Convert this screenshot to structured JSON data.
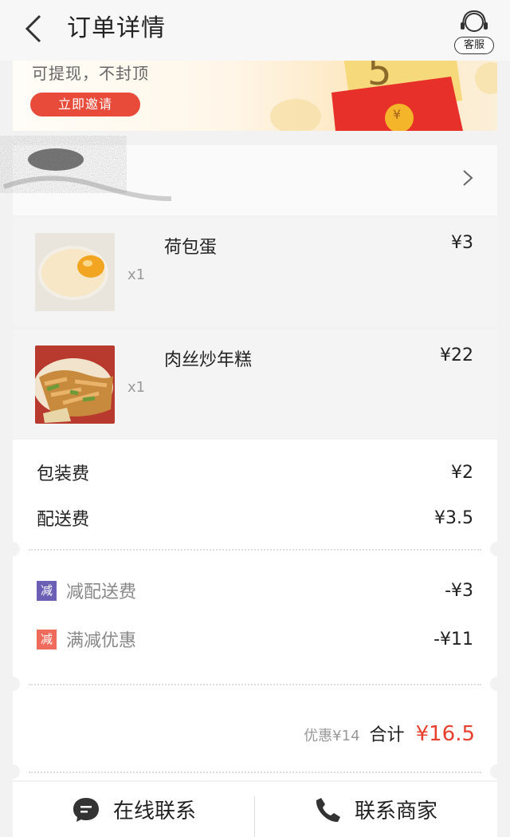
{
  "header": {
    "title": "订单详情",
    "service_label": "客服"
  },
  "banner": {
    "text": "可提现，不封顶",
    "button_label": "立即邀请",
    "envelope_amount": "5",
    "coin_symbol": "¥"
  },
  "items": [
    {
      "name": "荷包蛋",
      "qty": "x1",
      "price": "¥3",
      "image": "fried-egg"
    },
    {
      "name": "肉丝炒年糕",
      "qty": "x1",
      "price": "¥22",
      "image": "stir-fried-rice-cake"
    }
  ],
  "fees": [
    {
      "label": "包装费",
      "amount": "¥2"
    },
    {
      "label": "配送费",
      "amount": "¥3.5"
    }
  ],
  "discounts": [
    {
      "badge": "减",
      "badge_color": "#6b5fb5",
      "label": "减配送费",
      "amount": "-¥3"
    },
    {
      "badge": "减",
      "badge_color": "#ef6b5b",
      "label": "满减优惠",
      "amount": "-¥11"
    }
  ],
  "summary": {
    "saving": "优惠¥14",
    "total_label": "合计",
    "total_value": "¥16.5",
    "accent_color": "#e8402f"
  },
  "actions": {
    "chat_label": "在线联系",
    "call_label": "联系商家"
  }
}
